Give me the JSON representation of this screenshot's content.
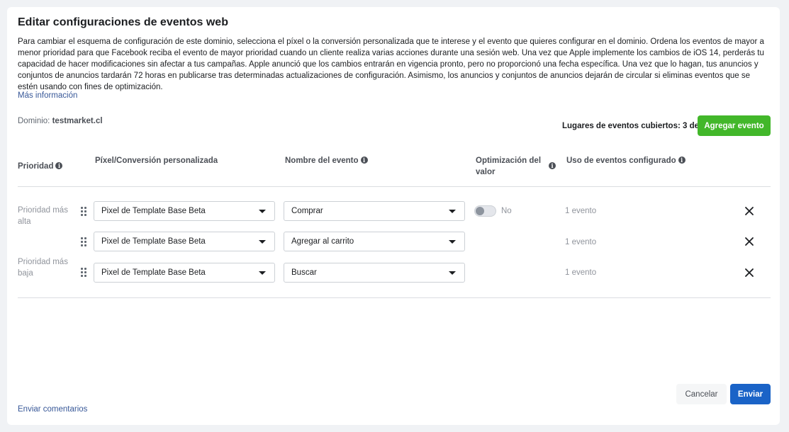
{
  "dialog": {
    "title": "Editar configuraciones de eventos web",
    "description": "Para cambiar el esquema de configuración de este dominio, selecciona el píxel o la conversión personalizada que te interese y el evento que quieres configurar en el dominio. Ordena los eventos de mayor a menor prioridad para que Facebook reciba el evento de mayor prioridad cuando un cliente realiza varias acciones durante una sesión web. Una vez que Apple implemente los cambios de iOS 14, perderás tu capacidad de hacer modificaciones sin afectar a tus campañas. Apple anunció que los cambios entrarán en vigencia pronto, pero no proporcionó una fecha específica. Una vez que lo hagan, tus anuncios y conjuntos de anuncios tardarán 72 horas en publicarse tras determinadas actualizaciones de configuración. Asimismo, los anuncios y conjuntos de anuncios dejarán de circular si eliminas eventos que se estén usando con fines de optimización.",
    "more_info": "Más información",
    "domain_label": "Dominio:",
    "domain_value": "testmarket.cl",
    "slots_text": "Lugares de eventos cubiertos: 3 de 8",
    "add_event_button": "Agregar evento"
  },
  "table": {
    "headers": {
      "priority": "Prioridad",
      "pixel": "Píxel/Conversión personalizada",
      "event_name": "Nombre del evento",
      "value_optimization_line1": "Optimización del",
      "value_optimization_line2": "valor",
      "usage": "Uso de eventos configurado"
    },
    "priority_high_line1": "Prioridad más",
    "priority_high_line2": "alta",
    "priority_low_line1": "Prioridad más",
    "priority_low_line2": "baja",
    "rows": [
      {
        "pixel": "Pixel de Template Base Beta",
        "event": "Comprar",
        "optimization": "No",
        "optimization_enabled": false,
        "usage": "1 evento"
      },
      {
        "pixel": "Pixel de Template Base Beta",
        "event": "Agregar al carrito",
        "usage": "1 evento"
      },
      {
        "pixel": "Pixel de Template Base Beta",
        "event": "Buscar",
        "usage": "1 evento"
      }
    ]
  },
  "footer": {
    "feedback_link": "Enviar comentarios",
    "cancel_button": "Cancelar",
    "send_button": "Enviar"
  },
  "colors": {
    "add_button": "#42b72a",
    "send_button": "#1a63c7",
    "link": "#385898"
  },
  "icons": [
    "info-icon",
    "drag-handle-icon",
    "caret-down-icon",
    "close-icon"
  ]
}
